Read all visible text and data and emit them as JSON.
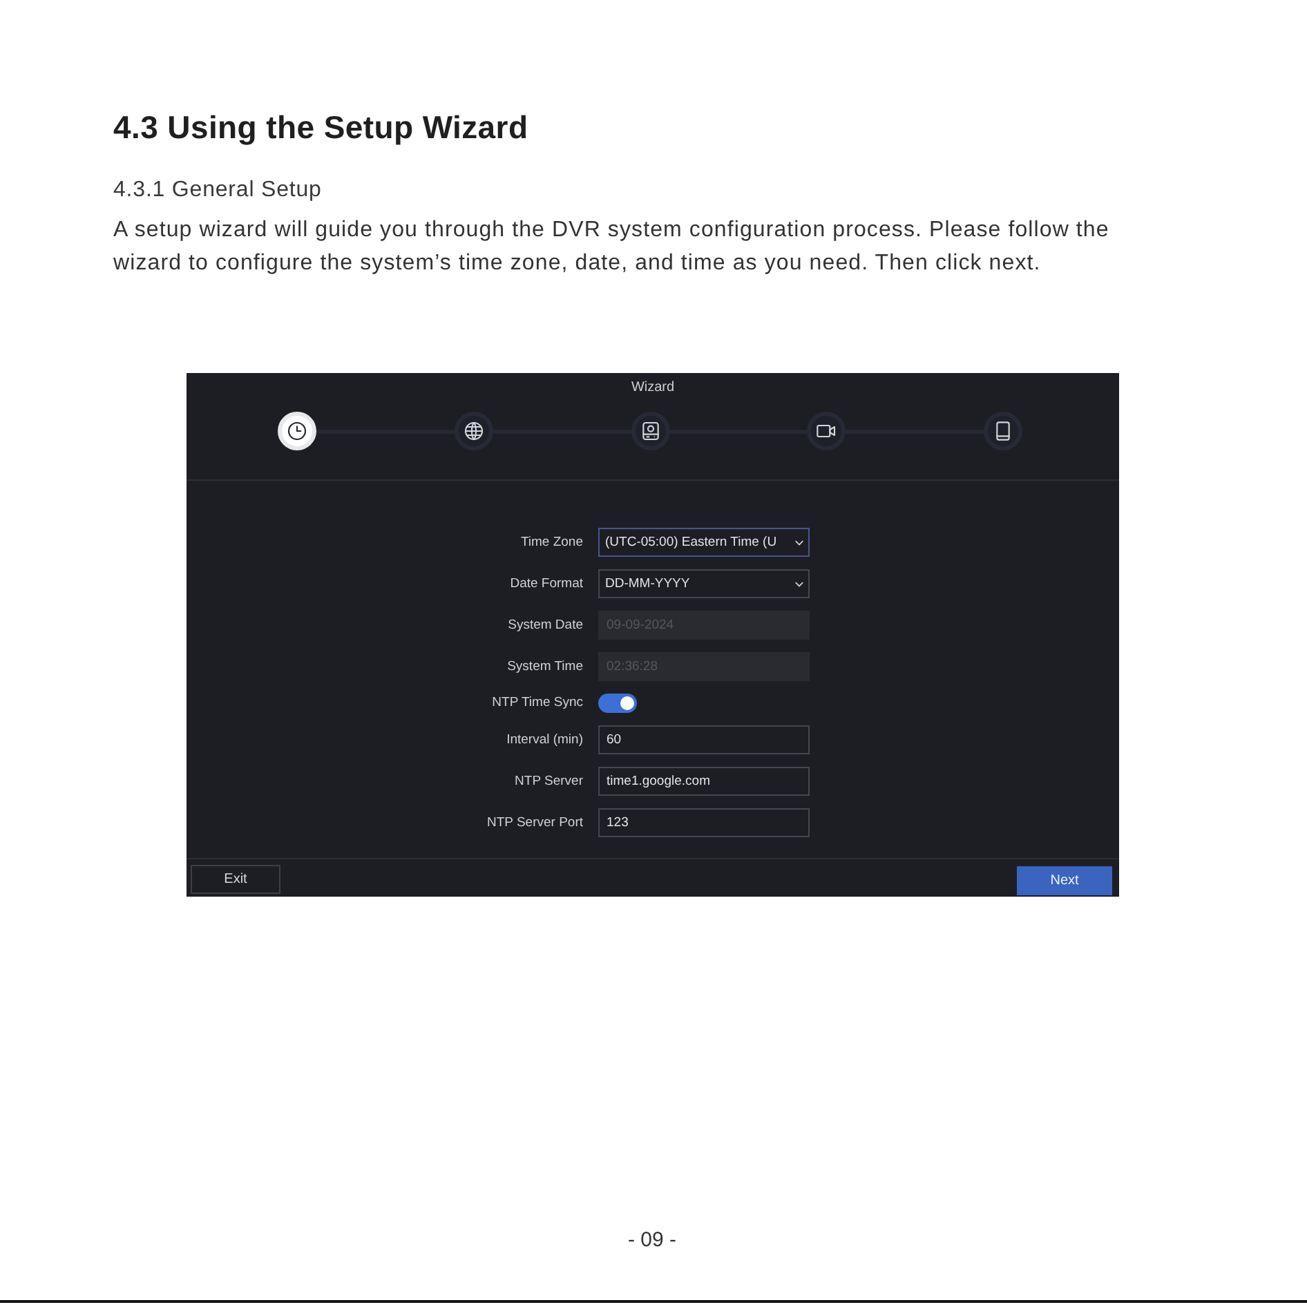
{
  "document": {
    "heading": "4.3 Using the Setup Wizard",
    "subheading": "4.3.1 General Setup",
    "paragraph": "A setup wizard will guide you through the DVR system configuration process. Please follow the wizard to configure the system’s time zone, date, and time as you need. Then click next.",
    "page_number": "- 09 -"
  },
  "wizard": {
    "title": "Wizard",
    "steps": [
      {
        "kind": "clock",
        "selected": true
      },
      {
        "kind": "globe",
        "selected": false
      },
      {
        "kind": "disk",
        "selected": false
      },
      {
        "kind": "camera",
        "selected": false
      },
      {
        "kind": "mobile",
        "selected": false
      }
    ],
    "fields": [
      {
        "label": "Time Zone",
        "kind": "select",
        "value": "(UTC-05:00) Eastern Time (U",
        "focused": true,
        "disabled": false
      },
      {
        "label": "Date Format",
        "kind": "select",
        "value": "DD-MM-YYYY",
        "focused": false,
        "disabled": false
      },
      {
        "label": "System Date",
        "kind": "input",
        "value": "09-09-2024",
        "focused": false,
        "disabled": true
      },
      {
        "label": "System Time",
        "kind": "input",
        "value": "02:36:28",
        "focused": false,
        "disabled": true
      },
      {
        "label": "NTP Time Sync",
        "kind": "toggle",
        "on": true
      },
      {
        "label": "Interval (min)",
        "kind": "input",
        "value": "60",
        "focused": false,
        "disabled": false
      },
      {
        "label": "NTP Server",
        "kind": "input",
        "value": "time1.google.com",
        "focused": false,
        "disabled": false
      },
      {
        "label": "NTP Server Port",
        "kind": "input",
        "value": "123",
        "focused": false,
        "disabled": false
      }
    ],
    "buttons": [
      {
        "label": "Exit",
        "kind": "secondary"
      },
      {
        "label": "Next",
        "kind": "primary"
      }
    ]
  }
}
